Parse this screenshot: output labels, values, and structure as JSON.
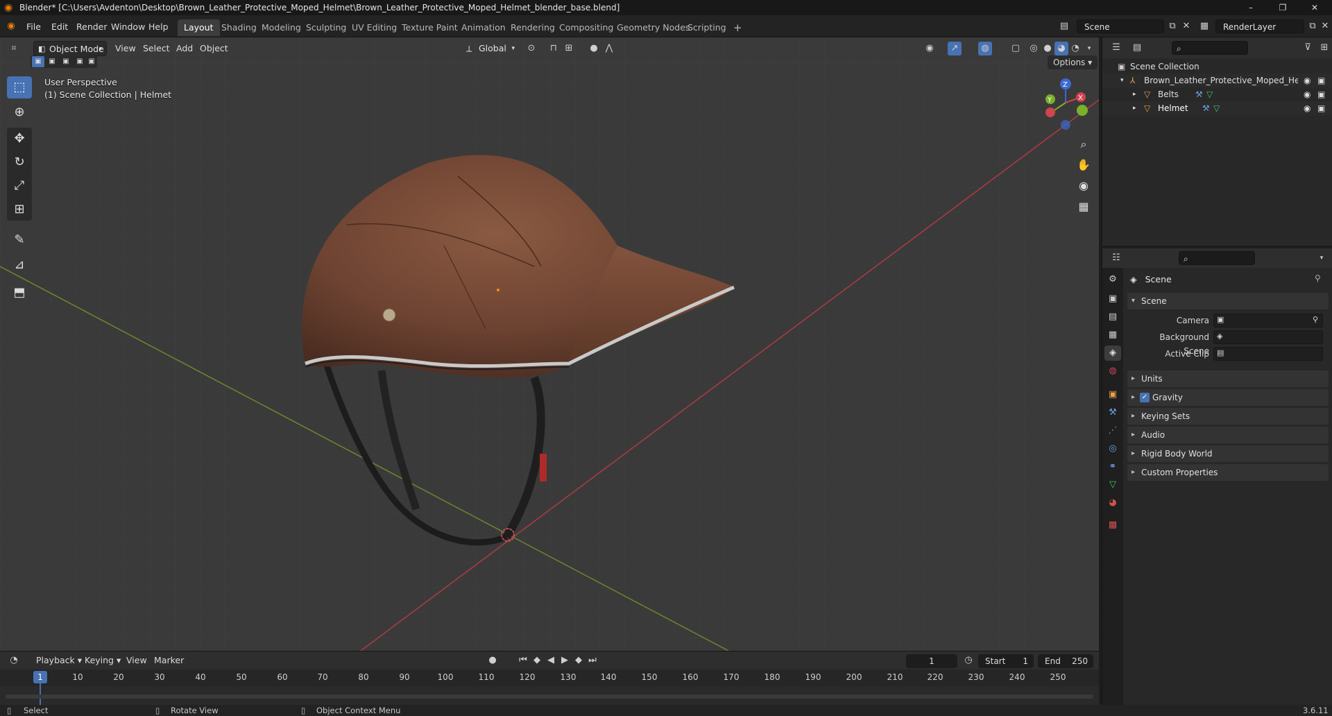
{
  "window": {
    "title": "Blender* [C:\\Users\\Avdenton\\Desktop\\Brown_Leather_Protective_Moped_Helmet\\Brown_Leather_Protective_Moped_Helmet_blender_base.blend]",
    "minimize": "–",
    "maximize": "❐",
    "close": "✕"
  },
  "menu": [
    "File",
    "Edit",
    "Render",
    "Window",
    "Help"
  ],
  "workspaces": [
    "Layout",
    "Shading",
    "Modeling",
    "Sculpting",
    "UV Editing",
    "Texture Paint",
    "Animation",
    "Rendering",
    "Compositing",
    "Geometry Nodes",
    "Scripting"
  ],
  "workspace_add": "+",
  "scene_field": "Scene",
  "renderlayer_field": "RenderLayer",
  "viewport": {
    "mode": "Object Mode",
    "menus": [
      "View",
      "Select",
      "Add",
      "Object"
    ],
    "transform_orientation": "Global",
    "options_label": "Options",
    "info_line1": "User Perspective",
    "info_line2": "(1) Scene Collection | Helmet",
    "gizmo": {
      "z": "Z",
      "y": "Y",
      "x": "X"
    }
  },
  "outliner": {
    "root": "Scene Collection",
    "collection": "Brown_Leather_Protective_Moped_Heln",
    "objects": [
      "Belts",
      "Helmet"
    ]
  },
  "properties": {
    "context": "Scene",
    "panel_scene": "Scene",
    "camera_label": "Camera",
    "background_label": "Background Scene",
    "clip_label": "Active Clip",
    "panels": [
      "Units",
      "Gravity",
      "Keying Sets",
      "Audio",
      "Rigid Body World",
      "Custom Properties"
    ],
    "gravity_checked": true
  },
  "timeline": {
    "menus": [
      "Playback",
      "Keying",
      "View",
      "Marker"
    ],
    "current_frame": "1",
    "start_label": "Start",
    "start_value": "1",
    "end_label": "End",
    "end_value": "250",
    "ticks": [
      "1",
      "10",
      "20",
      "30",
      "40",
      "50",
      "60",
      "70",
      "80",
      "90",
      "100",
      "110",
      "120",
      "130",
      "140",
      "150",
      "160",
      "170",
      "180",
      "190",
      "200",
      "210",
      "220",
      "230",
      "240",
      "250"
    ]
  },
  "statusbar": {
    "select": "Select",
    "rotate": "Rotate View",
    "context_menu": "Object Context Menu",
    "version": "3.6.11"
  }
}
